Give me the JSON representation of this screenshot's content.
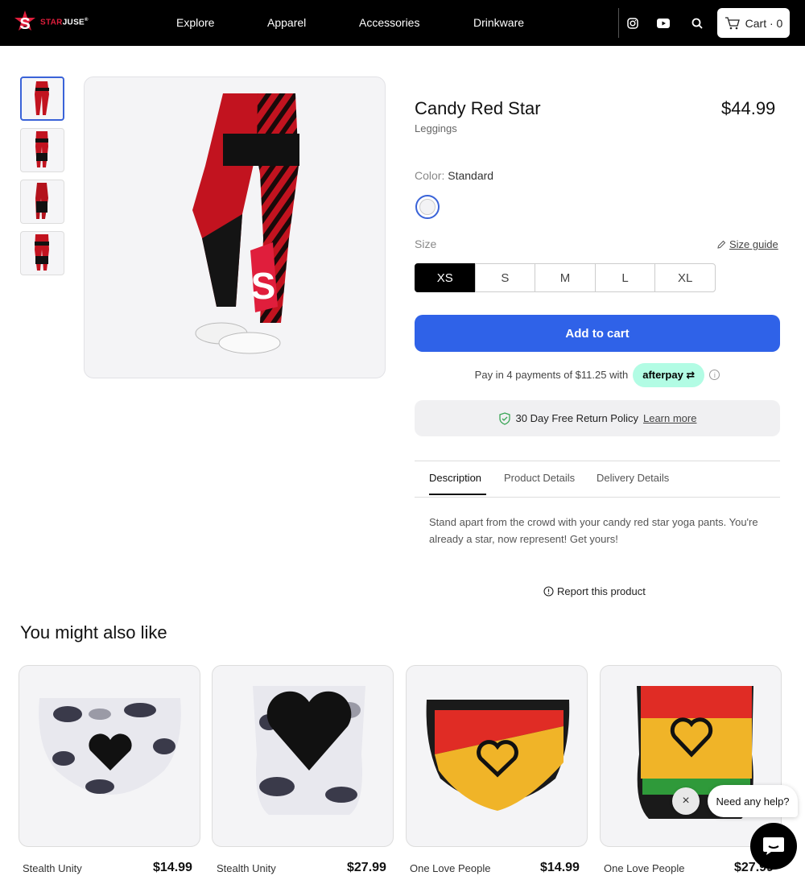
{
  "header": {
    "logo_text_red": "STAR",
    "logo_text_white": "JUSE",
    "logo_tm": "®",
    "nav": [
      "Explore",
      "Apparel",
      "Accessories",
      "Drinkware"
    ],
    "cart_label": "Cart · 0"
  },
  "product": {
    "title": "Candy Red Star",
    "price": "$44.99",
    "type": "Leggings",
    "color_label": "Color:",
    "color_value": "Standard",
    "size_label": "Size",
    "size_guide": "Size guide",
    "sizes": [
      "XS",
      "S",
      "M",
      "L",
      "XL"
    ],
    "selected_size": "XS",
    "add_to_cart": "Add to cart",
    "afterpay_text": "Pay in 4 payments of $11.25 with",
    "afterpay_badge": "afterpay",
    "return_policy": "30 Day Free Return Policy",
    "learn_more": "Learn more"
  },
  "tabs": [
    "Description",
    "Product Details",
    "Delivery Details"
  ],
  "description": "Stand apart from the crowd with your candy red star yoga pants. You're already a star, now represent! Get yours!",
  "report": "Report this product",
  "also_like": {
    "title": "You might also like",
    "items": [
      {
        "name": "Stealth Unity",
        "price": "$14.99"
      },
      {
        "name": "Stealth Unity",
        "price": "$27.99"
      },
      {
        "name": "One Love People",
        "price": "$14.99"
      },
      {
        "name": "One Love People",
        "price": "$27.99"
      }
    ]
  },
  "chat": {
    "prompt": "Need any help?",
    "close": "×"
  },
  "colors": {
    "accent": "#2f62e8",
    "afterpay": "#b2fce4",
    "brand_red": "#e01e3c"
  }
}
